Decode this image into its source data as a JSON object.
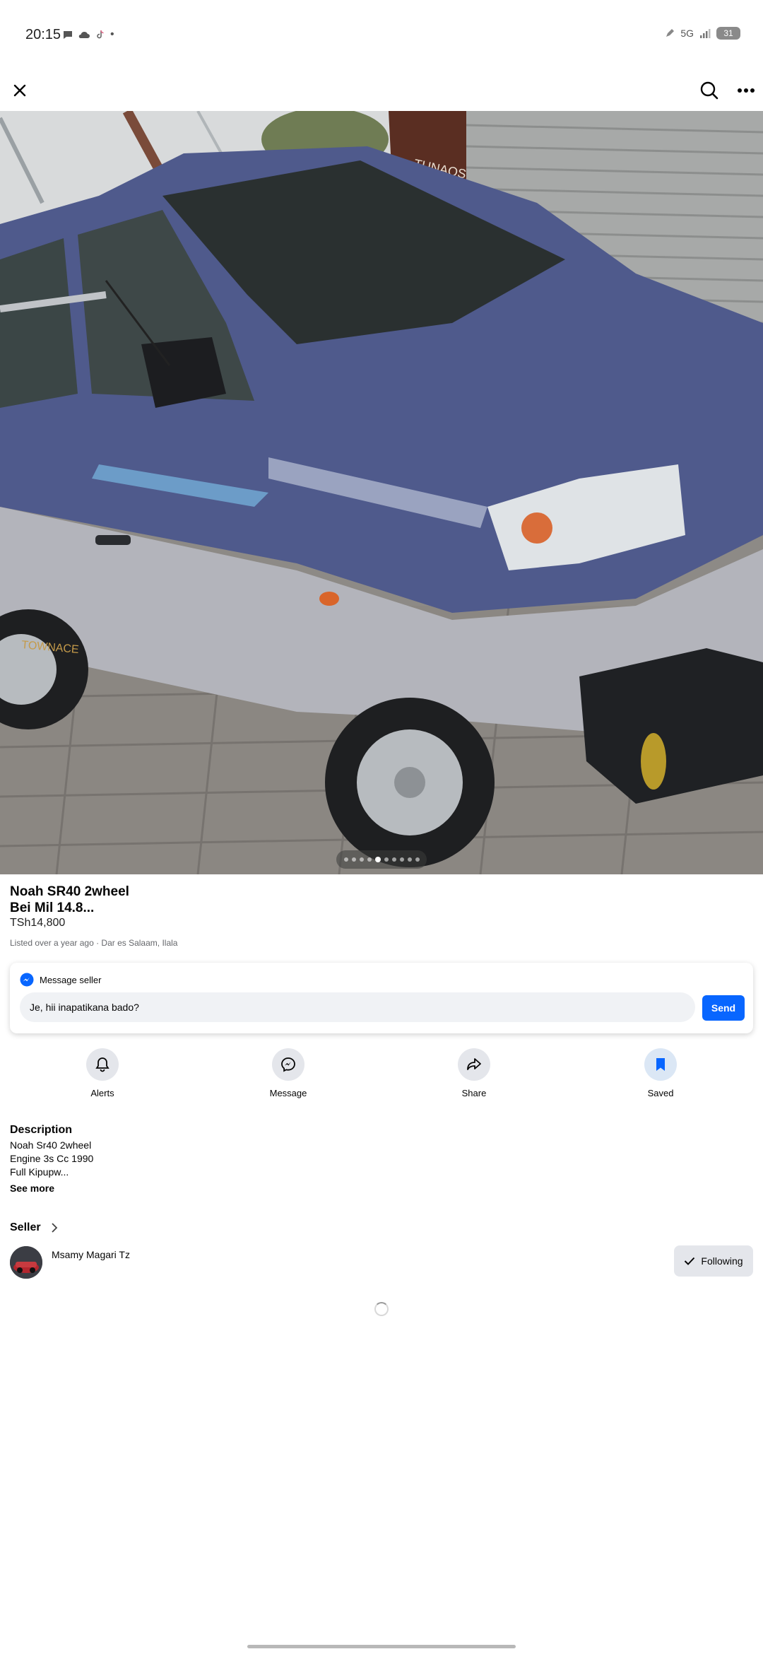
{
  "status_bar": {
    "time": "20:15",
    "network": "5G",
    "battery": "31",
    "left_icons": [
      "chat-bubble-icon",
      "cloud-icon",
      "tiktok-icon",
      "dot-icon"
    ],
    "right_icons": [
      "pen-icon",
      "signal-icon",
      "battery-icon"
    ]
  },
  "top_nav": {
    "close_icon": "close-icon",
    "search_icon": "search-icon",
    "more_icon": "more-horizontal-icon"
  },
  "gallery": {
    "image_count": 10,
    "active_index": 4
  },
  "listing": {
    "title_line1": "Noah SR40 2wheel",
    "title_line2": "Bei Mil 14.8...",
    "price": "TSh14,800",
    "meta": "Listed over a year ago · Dar es Salaam, Ilala"
  },
  "message_card": {
    "header_label": "Message seller",
    "input_value": "Je, hii inapatikana bado?",
    "send_label": "Send",
    "accent_color": "#0866ff"
  },
  "actions": [
    {
      "label": "Alerts",
      "icon": "bell-icon"
    },
    {
      "label": "Message",
      "icon": "messenger-icon"
    },
    {
      "label": "Share",
      "icon": "share-icon"
    },
    {
      "label": "Saved",
      "icon": "bookmark-icon"
    }
  ],
  "description": {
    "title": "Description",
    "lines": [
      "Noah Sr40 2wheel",
      "Engine 3s Cc 1990",
      "Full Kipupw..."
    ],
    "see_more": "See more"
  },
  "seller": {
    "section_title": "Seller",
    "name": "Msamy Magari Tz",
    "follow_label": "Following"
  }
}
